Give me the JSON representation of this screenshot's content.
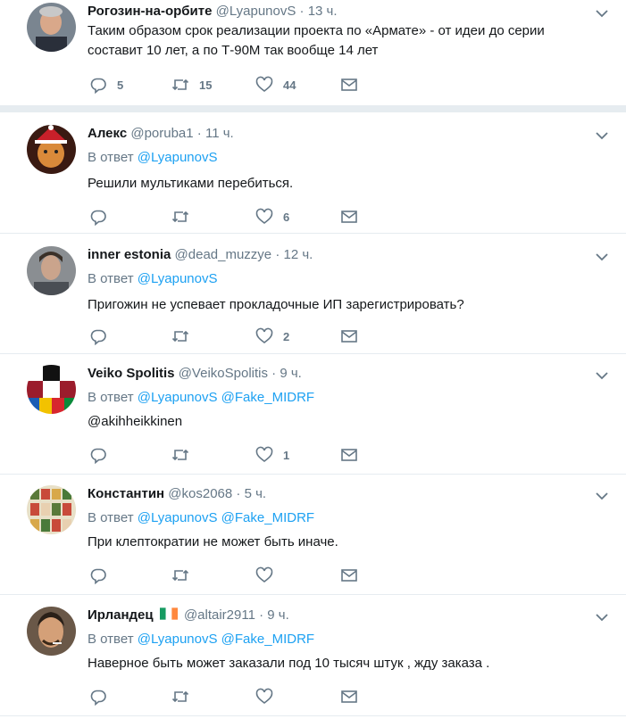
{
  "colors": {
    "link": "#1da1f2",
    "secondary": "#657786",
    "primary": "#14171a",
    "divider": "#e6ecf0"
  },
  "tweets": [
    {
      "name": "Рогозин-на-орбите",
      "handle": "@LyapunovS",
      "dot": "·",
      "time": "13 ч.",
      "text": "Таким образом срок реализации проекта по «Армате» - от идеи до серии составит 10 лет, а по Т-90М так вообще 14 лет",
      "replies": "5",
      "retweets": "15",
      "likes": "44"
    },
    {
      "name": "Алекс",
      "handle": "@poruba1",
      "dot": "·",
      "time": "11 ч.",
      "replying_prefix": "В ответ",
      "replying_to": [
        "@LyapunovS"
      ],
      "text": "Решили мультиками перебиться.",
      "replies": "",
      "retweets": "",
      "likes": "6"
    },
    {
      "name": "inner estonia",
      "handle": "@dead_muzzye",
      "dot": "·",
      "time": "12 ч.",
      "replying_prefix": "В ответ",
      "replying_to": [
        "@LyapunovS"
      ],
      "text": "Пригожин не успевает прокладочные ИП зарегистрировать?",
      "replies": "",
      "retweets": "",
      "likes": "2"
    },
    {
      "name": "Veiko Spolitis",
      "handle": "@VeikoSpolitis",
      "dot": "·",
      "time": "9 ч.",
      "replying_prefix": "В ответ",
      "replying_to": [
        "@LyapunovS",
        "@Fake_MIDRF"
      ],
      "text": "@akihheikkinen",
      "replies": "",
      "retweets": "",
      "likes": "1"
    },
    {
      "name": "Константин",
      "handle": "@kos2068",
      "dot": "·",
      "time": "5 ч.",
      "replying_prefix": "В ответ",
      "replying_to": [
        "@LyapunovS",
        "@Fake_MIDRF"
      ],
      "text": "При клептократии не может быть иначе.",
      "replies": "",
      "retweets": "",
      "likes": ""
    },
    {
      "name": "Ирландец",
      "flag": "irish-flag-icon",
      "handle": "@altair2911",
      "dot": "·",
      "time": "9 ч.",
      "replying_prefix": "В ответ",
      "replying_to": [
        "@LyapunovS",
        "@Fake_MIDRF"
      ],
      "text": "Наверное быть может заказали под 10 тысяч штук , жду заказа .",
      "replies": "",
      "retweets": "",
      "likes": ""
    }
  ],
  "icons": {
    "reply": "reply-icon",
    "retweet": "retweet-icon",
    "like": "heart-icon",
    "dm": "envelope-icon",
    "caret": "chevron-down-icon"
  }
}
